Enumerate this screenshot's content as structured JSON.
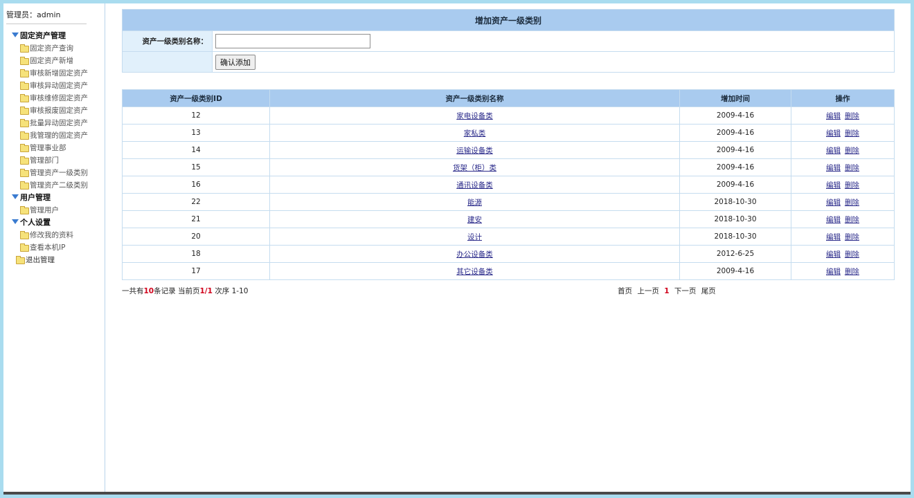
{
  "sidebar": {
    "admin_label": "管理员：admin",
    "groups": [
      {
        "label": "固定资产管理",
        "items": [
          "固定资产查询",
          "固定资产新增",
          "审核新增固定资产",
          "审核异动固定资产",
          "审核维修固定资产",
          "审核报废固定资产",
          "批量异动固定资产",
          "我管理的固定资产",
          "管理事业部",
          "管理部门",
          "管理资产一级类别",
          "管理资产二级类别"
        ]
      },
      {
        "label": "用户管理",
        "items": [
          "管理用户"
        ]
      },
      {
        "label": "个人设置",
        "items": [
          "修改我的资料",
          "查看本机IP"
        ]
      }
    ],
    "logout": "退出管理"
  },
  "form": {
    "title": "增加资产一级类别",
    "field_label": "资产一级类别名称：",
    "field_value": "",
    "submit_label": "确认添加"
  },
  "table": {
    "headers": [
      "资产一级类别ID",
      "资产一级类别名称",
      "增加时间",
      "操作"
    ],
    "rows": [
      {
        "id": "12",
        "name": "家电设备类",
        "date": "2009-4-16"
      },
      {
        "id": "13",
        "name": "家私类",
        "date": "2009-4-16"
      },
      {
        "id": "14",
        "name": "运输设备类",
        "date": "2009-4-16"
      },
      {
        "id": "15",
        "name": "货架（柜）类",
        "date": "2009-4-16"
      },
      {
        "id": "16",
        "name": "通讯设备类",
        "date": "2009-4-16"
      },
      {
        "id": "22",
        "name": "能源",
        "date": "2018-10-30"
      },
      {
        "id": "21",
        "name": "建安",
        "date": "2018-10-30"
      },
      {
        "id": "20",
        "name": "设计",
        "date": "2018-10-30"
      },
      {
        "id": "18",
        "name": "办公设备类",
        "date": "2012-6-25"
      },
      {
        "id": "17",
        "name": "其它设备类",
        "date": "2009-4-16"
      }
    ],
    "edit_label": "编辑",
    "delete_label": "删除"
  },
  "pager": {
    "total_prefix": "一共有",
    "total_count": "10",
    "total_suffix": "条记录 当前页",
    "current": "1/1",
    "order_text": " 次序 1-10",
    "first": "首页",
    "prev": "上一页",
    "page": "1",
    "next": "下一页",
    "last": "尾页"
  }
}
